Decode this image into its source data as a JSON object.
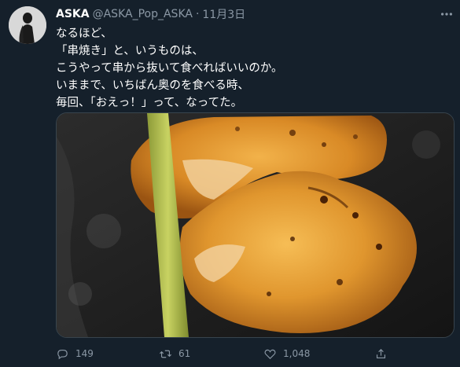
{
  "tweet": {
    "display_name": "ASKA",
    "handle": "@ASKA_Pop_ASKA",
    "separator": "·",
    "date": "11月3日",
    "text_lines": [
      "なるほど、",
      "「串焼き」と、いうものは、",
      "こうやって串から抜いて食べればいいのか。",
      "いままで、いちばん奥のを食べる時、",
      "毎回、「おえっ！」って、なってた。"
    ]
  },
  "actions": {
    "reply_count": "149",
    "retweet_count": "61",
    "like_count": "1,048"
  },
  "colors": {
    "background": "#15202b",
    "muted_text": "#8b98a5",
    "border": "#38444d"
  },
  "icons": [
    "more-icon",
    "reply-icon",
    "retweet-icon",
    "like-icon",
    "share-icon"
  ]
}
